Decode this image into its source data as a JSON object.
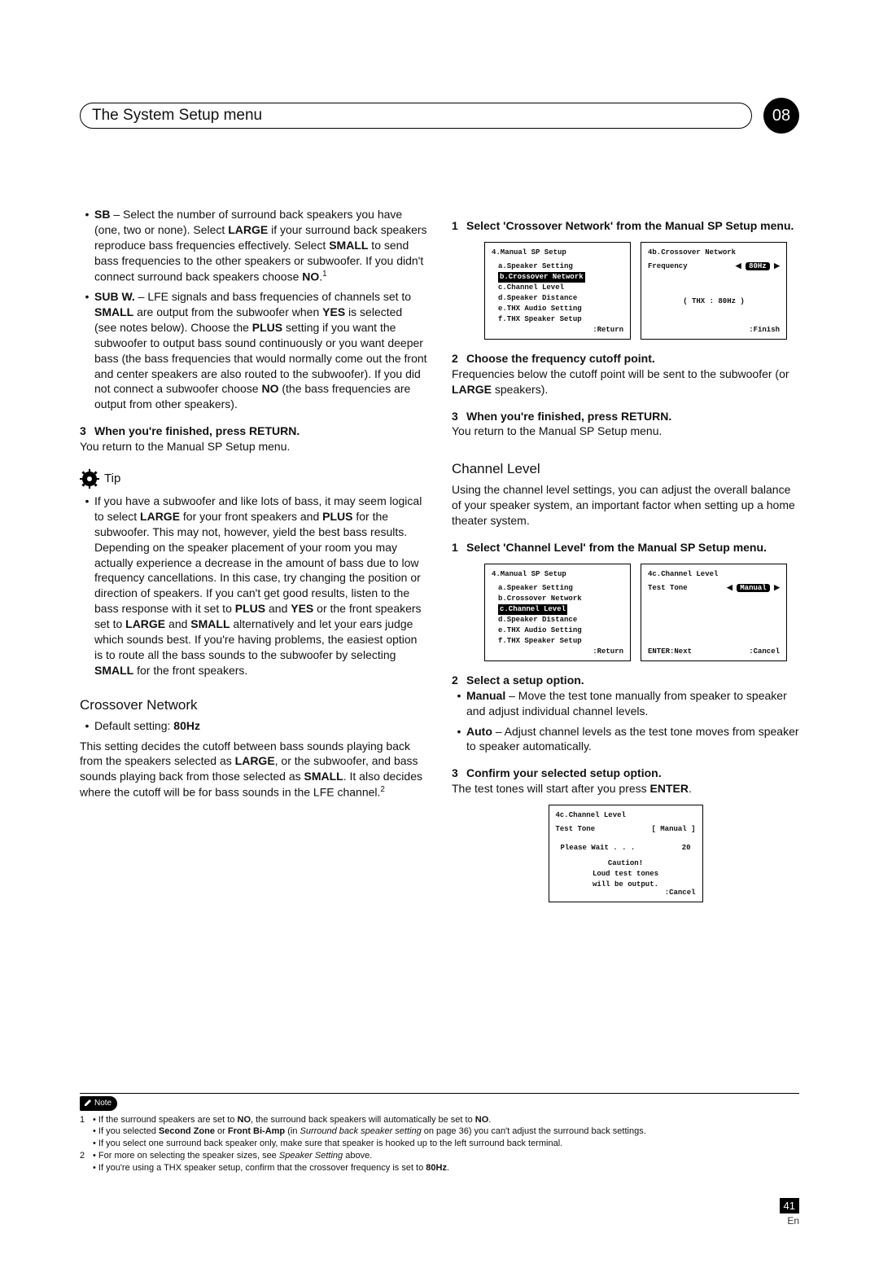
{
  "header": {
    "title": "The System Setup menu",
    "chapter": "08"
  },
  "left": {
    "sb": {
      "label": "SB",
      "text_a": " – Select the number of surround back speakers you have (one, two or none). Select ",
      "large": "LARGE",
      "text_b": " if your surround back speakers reproduce bass frequencies effectively. Select ",
      "small": "SMALL",
      "text_c": " to send bass frequencies to the other speakers or subwoofer. If you didn't connect surround back speakers choose ",
      "no": "NO",
      "text_d": "."
    },
    "subw": {
      "label": "SUB W.",
      "text_a": " – LFE signals and bass frequencies of channels set to ",
      "small1": "SMALL",
      "text_b": " are output from the subwoofer when ",
      "yes": "YES",
      "text_c": " is selected (see notes below). Choose the ",
      "plus": "PLUS",
      "text_d": " setting if you want the subwoofer to output bass sound continuously or you want deeper bass (the bass frequencies that would normally come out the front and center speakers are also routed to the subwoofer). If you did not connect a subwoofer choose ",
      "no": "NO",
      "text_e": " (the bass frequencies are output from other speakers)."
    },
    "step3": {
      "num": "3",
      "head": "When you're finished, press RETURN.",
      "body": "You return to the Manual SP Setup menu."
    },
    "tip": {
      "label": "Tip",
      "text_a": "If you have a subwoofer and like lots of bass, it may seem logical to select ",
      "large": "LARGE",
      "text_b": " for your front speakers and ",
      "plus": "PLUS",
      "text_c": " for the subwoofer. This may not, however, yield the best bass results. Depending on the speaker placement of your room you may actually experience a decrease in the amount of bass due to low frequency cancellations. In this case, try changing the position or direction of speakers. If you can't get good results, listen to the bass response with it set to ",
      "plus2": "PLUS",
      "text_d": " and ",
      "yes": "YES",
      "text_e": " or the front speakers set to ",
      "large2": "LARGE",
      "text_f": " and ",
      "small": "SMALL",
      "text_g": " alternatively and let your ears judge which sounds best. If you're having problems, the easiest option is to route all the bass sounds to the subwoofer by selecting ",
      "small2": "SMALL",
      "text_h": " for the front speakers."
    },
    "crossover": {
      "title": "Crossover Network",
      "default_label": "Default setting: ",
      "default_value": "80Hz",
      "para_a": "This setting decides the cutoff between bass sounds playing back from the speakers selected as ",
      "large": "LARGE",
      "para_b": ", or the subwoofer, and bass sounds playing back from those selected as ",
      "small": "SMALL",
      "para_c": ". It also decides where the cutoff will be for bass sounds in the LFE channel."
    }
  },
  "right": {
    "step1": {
      "num": "1",
      "head": "Select 'Crossover Network' from the Manual SP Setup menu."
    },
    "screen_a_title": "4.Manual SP Setup",
    "screen_a_items": [
      "a.Speaker Setting",
      "b.Crossover Network",
      "c.Channel Level",
      "d.Speaker Distance",
      "e.THX Audio Setting",
      "f.THX Speaker Setup"
    ],
    "screen_a_return": ":Return",
    "screen_b_title": "4b.Crossover Network",
    "screen_b_freq_label": "Frequency",
    "screen_b_freq_value": "80Hz",
    "screen_b_thx": "( THX : 80Hz )",
    "screen_b_finish": ":Finish",
    "step2": {
      "num": "2",
      "head": "Choose the frequency cutoff point.",
      "body_a": "Frequencies below the cutoff point will be sent to the subwoofer (or ",
      "large": "LARGE",
      "body_b": " speakers)."
    },
    "step3": {
      "num": "3",
      "head": "When you're finished, press RETURN.",
      "body": "You return to the Manual SP Setup menu."
    },
    "channel": {
      "title": "Channel Level",
      "intro": "Using the channel level settings, you can adjust the overall balance of your speaker system, an important factor when setting up a home theater system."
    },
    "cstep1": {
      "num": "1",
      "head": "Select 'Channel Level' from the Manual SP Setup menu."
    },
    "screen_c_title": "4.Manual SP Setup",
    "screen_c_items": [
      "a.Speaker Setting",
      "b.Crossover Network",
      "c.Channel Level",
      "d.Speaker Distance",
      "e.THX Audio Setting",
      "f.THX Speaker Setup"
    ],
    "screen_c_return": ":Return",
    "screen_d_title": "4c.Channel Level",
    "screen_d_test_tone": "Test Tone",
    "screen_d_mode": "Manual",
    "screen_d_enter": "ENTER:Next",
    "screen_d_cancel": ":Cancel",
    "cstep2": {
      "num": "2",
      "head": "Select a setup option."
    },
    "manual": {
      "label": "Manual",
      "text": " – Move the test tone manually from speaker to speaker and adjust individual channel levels."
    },
    "auto": {
      "label": "Auto",
      "text": " – Adjust channel levels as the test tone moves from speaker to speaker automatically."
    },
    "cstep3": {
      "num": "3",
      "head": "Confirm your selected setup option.",
      "body_a": "The test tones will start after you press ",
      "enter": "ENTER",
      "body_b": "."
    },
    "screen_e_title": "4c.Channel Level",
    "screen_e_test": "Test Tone",
    "screen_e_mode": "[ Manual ]",
    "screen_e_wait": "Please Wait . . .",
    "screen_e_count": "20",
    "screen_e_caution": "Caution!",
    "screen_e_loud1": "Loud test tones",
    "screen_e_loud2": "will be output.",
    "screen_e_cancel": ":Cancel"
  },
  "foot": {
    "note_label": "Note",
    "n1a": "If the surround speakers are set to ",
    "n1a_no": "NO",
    "n1b": ", the surround back speakers will automatically be set to ",
    "n1b_no": "NO",
    "n1c": ".",
    "n2a": "If you selected ",
    "n2_second": "Second Zone",
    "n2b": " or ",
    "n2_biamp": "Front Bi-Amp",
    "n2c": " (in ",
    "n2_sb": "Surround back speaker setting",
    "n2d": " on page 36) you can't adjust the surround back settings.",
    "n3": "If you select one surround back speaker only, make sure that speaker is hooked up to the left surround back terminal.",
    "n4a": "For more on selecting the speaker sizes, see ",
    "n4_link": "Speaker Setting",
    "n4b": " above.",
    "n5a": "If you're using a THX speaker setup, confirm that the crossover frequency is set to ",
    "n5_hz": "80Hz",
    "n5b": "."
  },
  "page": {
    "number": "41",
    "lang": "En"
  }
}
